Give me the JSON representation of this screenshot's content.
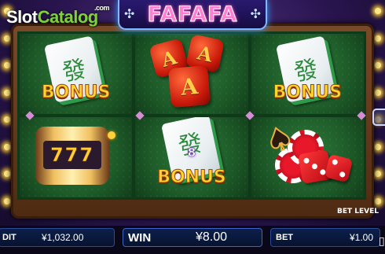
{
  "watermark": {
    "slot": "Slot",
    "catalog": "Catalog",
    "com": ".com"
  },
  "header": {
    "title": "FAFAFA"
  },
  "reels": {
    "cells": [
      {
        "symbol": "bonus-tile",
        "glyph": "發",
        "label": "BONUS"
      },
      {
        "symbol": "red-a-dice",
        "letters": [
          "A",
          "A",
          "A"
        ]
      },
      {
        "symbol": "bonus-tile",
        "glyph": "發",
        "label": "BONUS"
      },
      {
        "symbol": "seven-barrel",
        "label": "777"
      },
      {
        "symbol": "bonus-tile",
        "glyph": "發",
        "number": "8",
        "label": "BONUS"
      },
      {
        "symbol": "spade-chips-dice"
      }
    ]
  },
  "bottom_bar": {
    "bet_level_label": "BET LEVEL",
    "credit_label": "DIT",
    "credit_value": "¥1,032.00",
    "win_label": "WIN",
    "win_value": "¥8.00",
    "bet_label": "BET",
    "bet_value": "¥1.00"
  },
  "colors": {
    "felt": "#1d5a28",
    "title_pink": "#ff7fd0",
    "bonus_gold": "#ffd630",
    "panel_blue": "#0d1f4a"
  }
}
